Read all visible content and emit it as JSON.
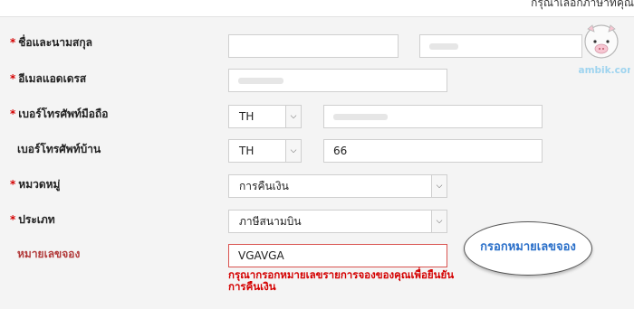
{
  "header": {
    "language_note": "กรุณาเลือกภาษาที่คุณ"
  },
  "logo": {
    "text": "bambik.com",
    "icon": "pig-icon",
    "color": "#9fd4ef"
  },
  "form": {
    "fullname": {
      "label": "ชื่อและนามสกุล",
      "required": "*"
    },
    "email": {
      "label": "อีเมลแอดเดรส",
      "required": "*"
    },
    "mobile": {
      "label": "เบอร์โทรศัพท์มือถือ",
      "required": "*",
      "country": "TH"
    },
    "home_phone": {
      "label": "เบอร์โทรศัพท์บ้าน",
      "country": "TH",
      "value": "66"
    },
    "category": {
      "label": "หมวดหมู่",
      "required": "*",
      "value": "การคืนเงิน"
    },
    "type": {
      "label": "ประเภท",
      "required": "*",
      "value": "ภาษีสนามบิน"
    },
    "booking": {
      "label": "หมายเลขจอง",
      "value": "VGAVGA",
      "error": "กรุณากรอกหมายเลขรายการจองของคุณเพื่อยืนยันการคืนเงิน"
    }
  },
  "callout": {
    "text": "กรอกหมายเลขจอง"
  },
  "colors": {
    "error": "#d40000",
    "accent": "#2a6fc9",
    "panel": "#f4f4f4"
  },
  "icons": {
    "dropdown": "chevron-down-icon"
  }
}
